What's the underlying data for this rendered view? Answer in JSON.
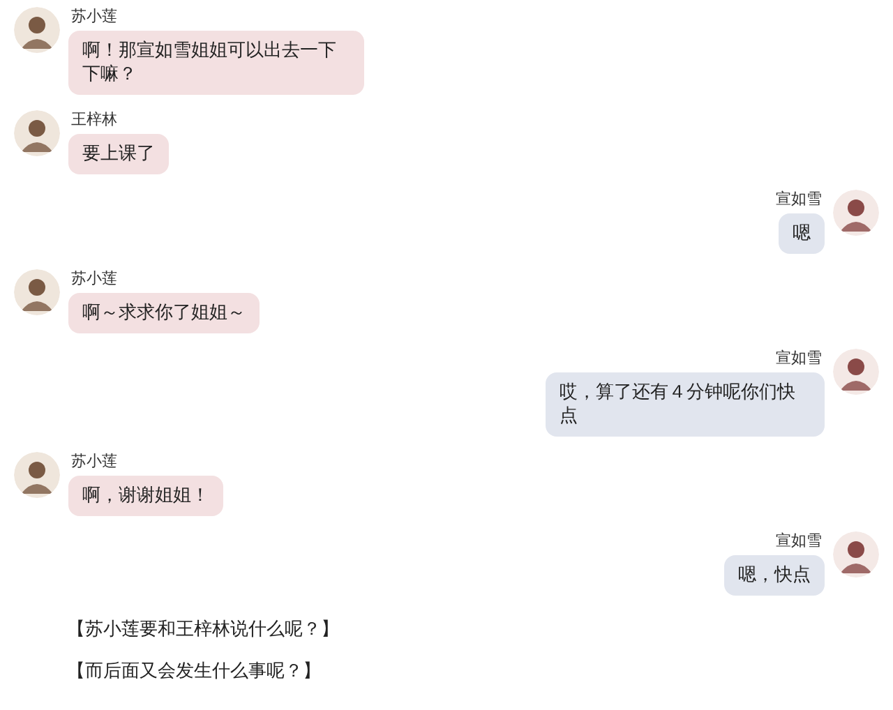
{
  "messages": [
    {
      "kind": "received",
      "sender": "苏小莲",
      "text": "啊！那宣如雪姐姐可以出去一下下嘛？"
    },
    {
      "kind": "received",
      "sender": "王梓林",
      "text": "要上课了"
    },
    {
      "kind": "sent",
      "sender": "宣如雪",
      "text": "嗯"
    },
    {
      "kind": "received",
      "sender": "苏小莲",
      "text": "啊～求求你了姐姐～"
    },
    {
      "kind": "sent",
      "sender": "宣如雪",
      "text": "哎，算了还有４分钟呢你们快点"
    },
    {
      "kind": "received",
      "sender": "苏小莲",
      "text": "啊，谢谢姐姐！"
    },
    {
      "kind": "sent",
      "sender": "宣如雪",
      "text": "嗯，快点"
    }
  ],
  "narration": [
    "【苏小莲要和王梓林说什么呢？】",
    "【而后面又会发生什么事呢？】"
  ]
}
